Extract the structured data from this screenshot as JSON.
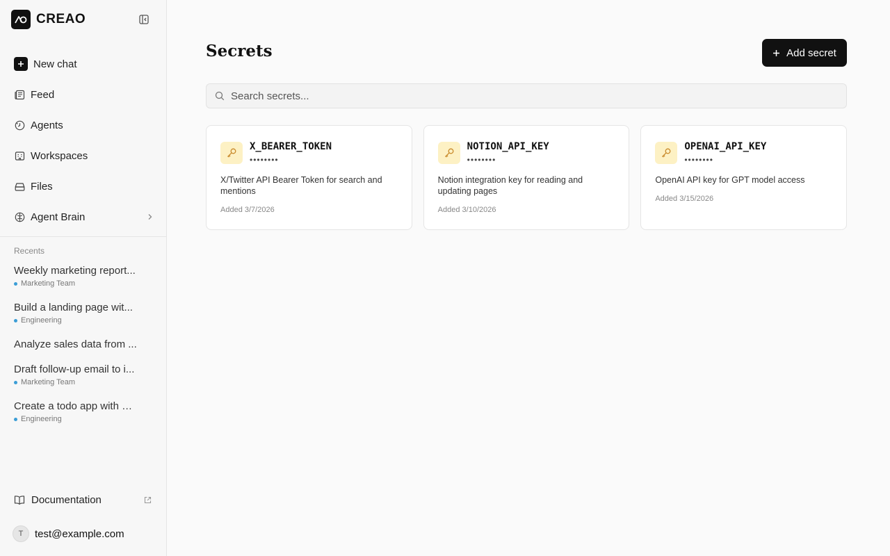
{
  "app": {
    "brand": "CREAO"
  },
  "sidebar": {
    "nav": [
      {
        "label": "New chat",
        "icon": "plus-icon"
      },
      {
        "label": "Feed",
        "icon": "newspaper-icon"
      },
      {
        "label": "Agents",
        "icon": "agent-icon"
      },
      {
        "label": "Workspaces",
        "icon": "building-icon"
      },
      {
        "label": "Files",
        "icon": "drive-icon"
      },
      {
        "label": "Agent Brain",
        "icon": "brain-icon"
      }
    ],
    "recents_label": "Recents",
    "recents": [
      {
        "title": "Weekly marketing report...",
        "tag": "Marketing Team"
      },
      {
        "title": "Build a landing page wit...",
        "tag": "Engineering"
      },
      {
        "title": "Analyze sales data from ...",
        "tag": ""
      },
      {
        "title": "Draft follow-up email to i...",
        "tag": "Marketing Team"
      },
      {
        "title": "Create a todo app with R...",
        "tag": "Engineering"
      }
    ],
    "documentation": "Documentation",
    "user": {
      "initial": "T",
      "email": "test@example.com"
    }
  },
  "main": {
    "title": "Secrets",
    "add_button": "Add secret",
    "search_placeholder": "Search secrets...",
    "secrets": [
      {
        "name": "X_BEARER_TOKEN",
        "mask": "••••••••",
        "description": "X/Twitter API Bearer Token for search and mentions",
        "added": "Added 3/7/2026"
      },
      {
        "name": "NOTION_API_KEY",
        "mask": "••••••••",
        "description": "Notion integration key for reading and updating pages",
        "added": "Added 3/10/2026"
      },
      {
        "name": "OPENAI_API_KEY",
        "mask": "••••••••",
        "description": "OpenAI API key for GPT model access",
        "added": "Added 3/15/2026"
      }
    ]
  },
  "colors": {
    "accent": "#111111",
    "key_badge_bg": "#fdf1c4",
    "key_icon": "#c98a2b",
    "tag_dot": "#3b9dd6"
  }
}
